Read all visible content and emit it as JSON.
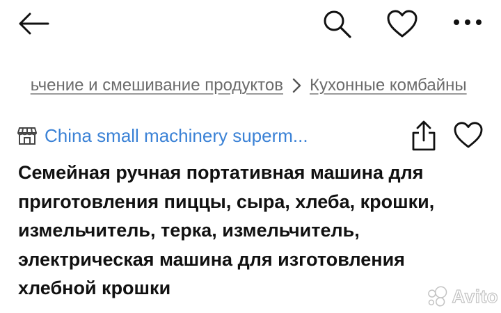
{
  "header": {
    "back_icon": "arrow-left-icon",
    "search_icon": "search-icon",
    "favorite_icon": "heart-icon",
    "more_icon": "more-dots-icon"
  },
  "breadcrumb": {
    "items": [
      "ьчение и смешивание продуктов",
      "Кухонные комбайны"
    ],
    "separator_icon": "chevron-right-icon"
  },
  "product": {
    "seller_icon": "store-icon",
    "seller_name": "China small machinery superm...",
    "share_icon": "share-icon",
    "favorite_icon": "heart-icon",
    "title": "Семейная ручная портативная машина для приготовления пиццы, сыра, хлеба, крошки, измельчитель, терка, измельчитель, электрическая машина для изготовления хлебной крошки"
  },
  "watermark": {
    "text": "Avito"
  },
  "colors": {
    "text": "#111111",
    "muted": "#6b6b6b",
    "link": "#3b82d6",
    "background": "#ffffff"
  }
}
